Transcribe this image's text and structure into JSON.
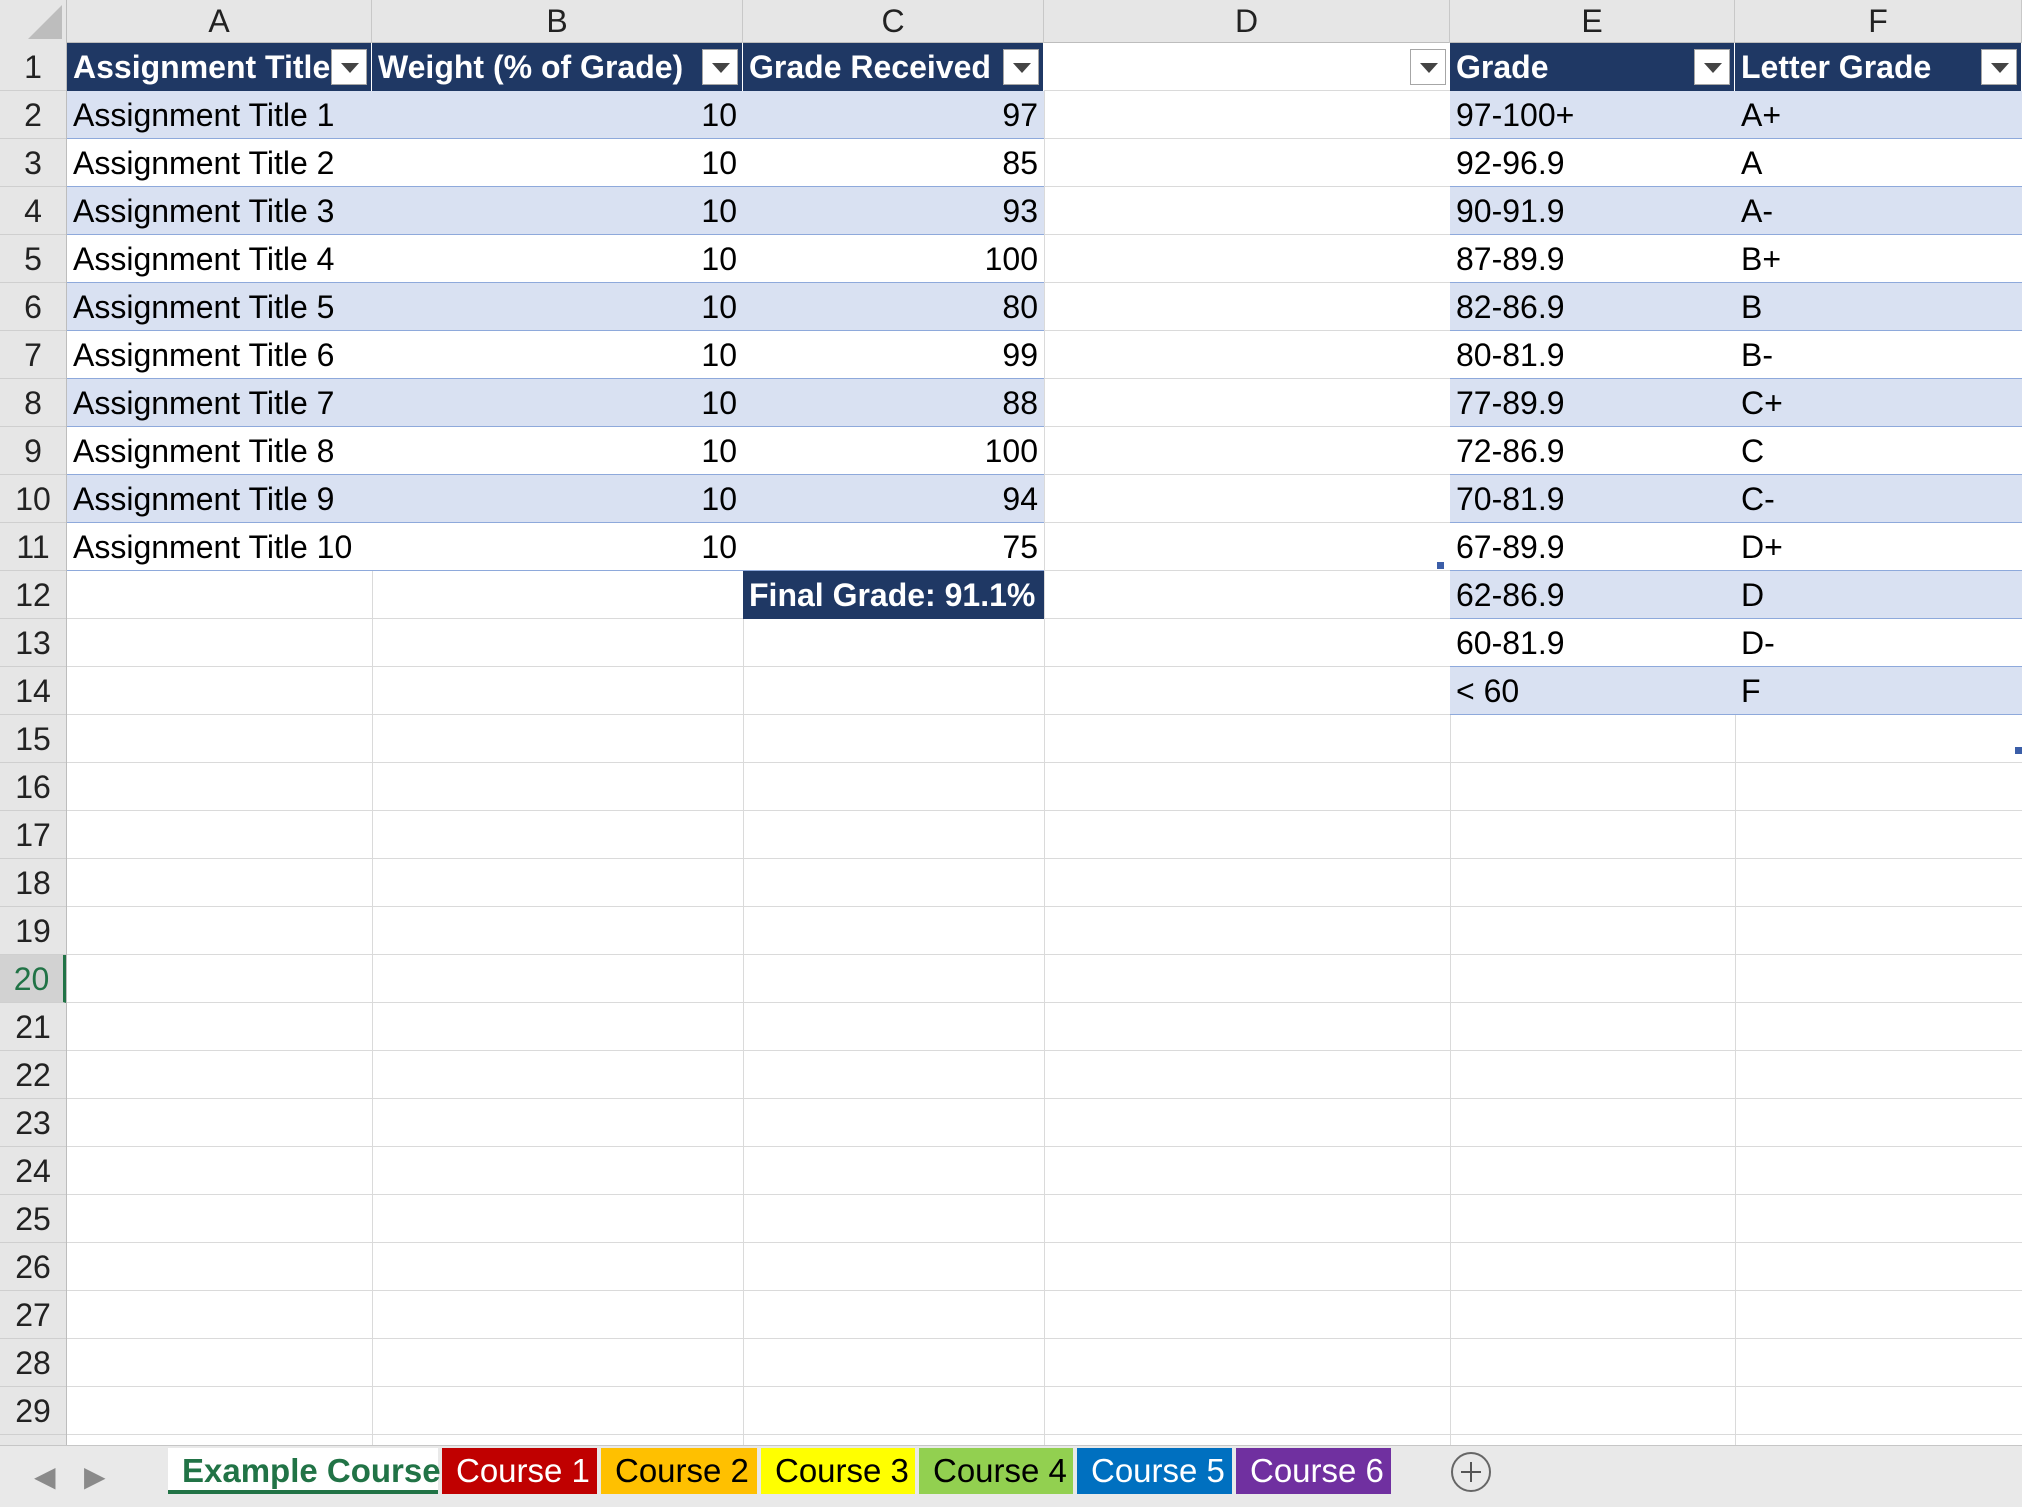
{
  "columns": [
    "A",
    "B",
    "C",
    "D",
    "E",
    "F"
  ],
  "rows": [
    "1",
    "2",
    "3",
    "4",
    "5",
    "6",
    "7",
    "8",
    "9",
    "10",
    "11",
    "12",
    "13",
    "14",
    "15",
    "16",
    "17",
    "18",
    "19",
    "20",
    "21",
    "22",
    "23",
    "24",
    "25",
    "26",
    "27",
    "28",
    "29"
  ],
  "selected_row": "20",
  "assignments": {
    "headers": [
      "Assignment Title",
      "Weight (% of Grade)",
      "Grade Received"
    ],
    "rows": [
      [
        "Assignment Title 1",
        "10",
        "97"
      ],
      [
        "Assignment Title 2",
        "10",
        "85"
      ],
      [
        "Assignment Title 3",
        "10",
        "93"
      ],
      [
        "Assignment Title 4",
        "10",
        "100"
      ],
      [
        "Assignment Title 5",
        "10",
        "80"
      ],
      [
        "Assignment Title 6",
        "10",
        "99"
      ],
      [
        "Assignment Title 7",
        "10",
        "88"
      ],
      [
        "Assignment Title 8",
        "10",
        "100"
      ],
      [
        "Assignment Title 9",
        "10",
        "94"
      ],
      [
        "Assignment Title 10",
        "10",
        "75"
      ]
    ],
    "final_grade": "Final Grade: 91.1%"
  },
  "scale": {
    "headers": [
      "Grade",
      "Letter Grade"
    ],
    "rows": [
      [
        "97-100+",
        "A+"
      ],
      [
        "92-96.9",
        "A"
      ],
      [
        "90-91.9",
        "A-"
      ],
      [
        "87-89.9",
        "B+"
      ],
      [
        "82-86.9",
        "B"
      ],
      [
        "80-81.9",
        "B-"
      ],
      [
        "77-89.9",
        "C+"
      ],
      [
        "72-86.9",
        "C"
      ],
      [
        "70-81.9",
        "C-"
      ],
      [
        "67-89.9",
        "D+"
      ],
      [
        "62-86.9",
        "D"
      ],
      [
        "60-81.9",
        "D-"
      ],
      [
        "< 60",
        "F"
      ]
    ]
  },
  "sheet_tabs": [
    {
      "label": "Example Course",
      "active": true,
      "color": "#ffffff",
      "text_color": "#217346"
    },
    {
      "label": "Course 1",
      "active": false,
      "color": "#c00000",
      "text_color": "#ffffff"
    },
    {
      "label": "Course 2",
      "active": false,
      "color": "#ffc000",
      "text_color": "#000000"
    },
    {
      "label": "Course 3",
      "active": false,
      "color": "#ffff00",
      "text_color": "#000000"
    },
    {
      "label": "Course 4",
      "active": false,
      "color": "#92d050",
      "text_color": "#000000"
    },
    {
      "label": "Course 5",
      "active": false,
      "color": "#0070c0",
      "text_color": "#ffffff"
    },
    {
      "label": "Course 6",
      "active": false,
      "color": "#7030a0",
      "text_color": "#ffffff"
    }
  ],
  "nav_icons": [
    "chevron-left-icon",
    "chevron-right-icon",
    "plus-circle-icon"
  ],
  "colors": {
    "table_header": "#1f3864",
    "band": "#d9e1f2",
    "excel_green": "#217346"
  }
}
